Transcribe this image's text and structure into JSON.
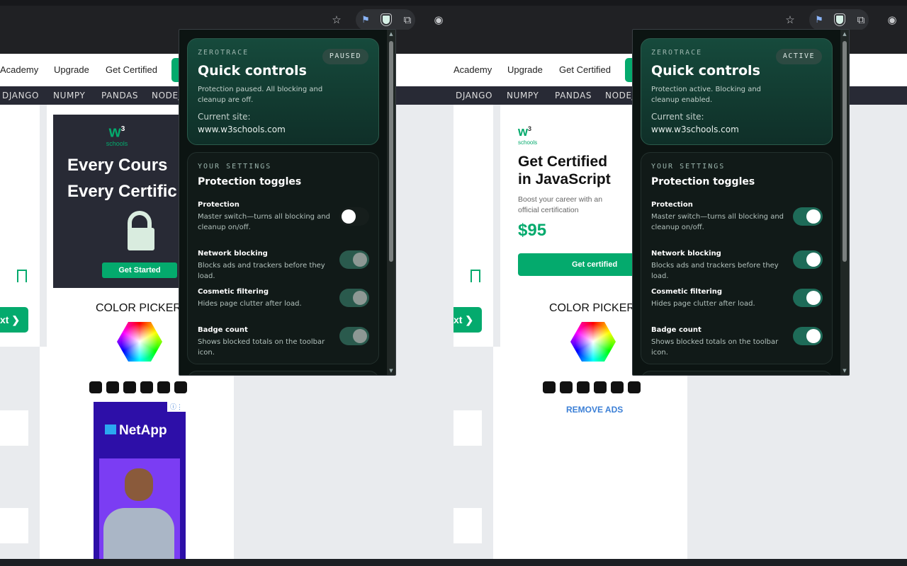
{
  "left": {
    "nav": {
      "academy": "Academy",
      "upgrade": "Upgrade",
      "get_certified": "Get Certified"
    },
    "subnav": [
      "DJANGO",
      "NUMPY",
      "PANDAS",
      "NODEJ"
    ],
    "ad": {
      "logo_top": "w",
      "logo_sup": "3",
      "logo_bottom": "schools",
      "line1": "Every Cours",
      "line2": "Every Certific",
      "cta": "Get Started"
    },
    "next_label": "xt ❯",
    "color_picker": "COLOR PICKER",
    "netapp_logo": "NetApp",
    "popup": {
      "eyebrow": "ZEROTRACE",
      "title": "Quick controls",
      "status": "PAUSED",
      "description": "Protection paused. All blocking and cleanup are off.",
      "site_label": "Current site:",
      "site_value": "www.w3schools.com",
      "settings_eyebrow": "YOUR SETTINGS",
      "settings_title": "Protection toggles",
      "toggles": [
        {
          "title": "Protection",
          "desc": "Master switch—turns all blocking and cleanup on/off.",
          "state": "off"
        },
        {
          "title": "Network blocking",
          "desc": "Blocks ads and trackers before they load.",
          "state": "disabled-on"
        },
        {
          "title": "Cosmetic filtering",
          "desc": "Hides page clutter after load.",
          "state": "disabled-on"
        },
        {
          "title": "Badge count",
          "desc": "Shows blocked totals on the toolbar icon.",
          "state": "disabled-on"
        }
      ]
    }
  },
  "right": {
    "nav": {
      "academy": "Academy",
      "upgrade": "Upgrade",
      "get_certified": "Get Certified"
    },
    "subnav": [
      "DJANGO",
      "NUMPY",
      "PANDAS",
      "NODEJ"
    ],
    "ad": {
      "logo_top": "w",
      "logo_sup": "3",
      "logo_bottom": "schools",
      "title": "Get Certified in JavaScript",
      "subtitle": "Boost your career with an official certification",
      "price": "$95",
      "cta": "Get certified"
    },
    "next_label": "xt ❯",
    "color_picker": "COLOR PICKER",
    "remove_ads": "REMOVE ADS",
    "popup": {
      "eyebrow": "ZEROTRACE",
      "title": "Quick controls",
      "status": "ACTIVE",
      "description": "Protection active. Blocking and cleanup enabled.",
      "site_label": "Current site:",
      "site_value": "www.w3schools.com",
      "settings_eyebrow": "YOUR SETTINGS",
      "settings_title": "Protection toggles",
      "toggles": [
        {
          "title": "Protection",
          "desc": "Master switch—turns all blocking and cleanup on/off.",
          "state": "on"
        },
        {
          "title": "Network blocking",
          "desc": "Blocks ads and trackers before they load.",
          "state": "on"
        },
        {
          "title": "Cosmetic filtering",
          "desc": "Hides page clutter after load.",
          "state": "on"
        },
        {
          "title": "Badge count",
          "desc": "Shows blocked totals on the toolbar icon.",
          "state": "on"
        }
      ]
    }
  },
  "toolbar_icons": [
    "star-icon",
    "pin-extension-icon",
    "zerotrace-shield-icon",
    "extensions-puzzle-icon",
    "profile-icon"
  ],
  "colors": {
    "accent": "#04aa6d",
    "popup_bg": "#0c1412",
    "card_green": "#164a3c",
    "toggle_on": "#1e6b58"
  }
}
